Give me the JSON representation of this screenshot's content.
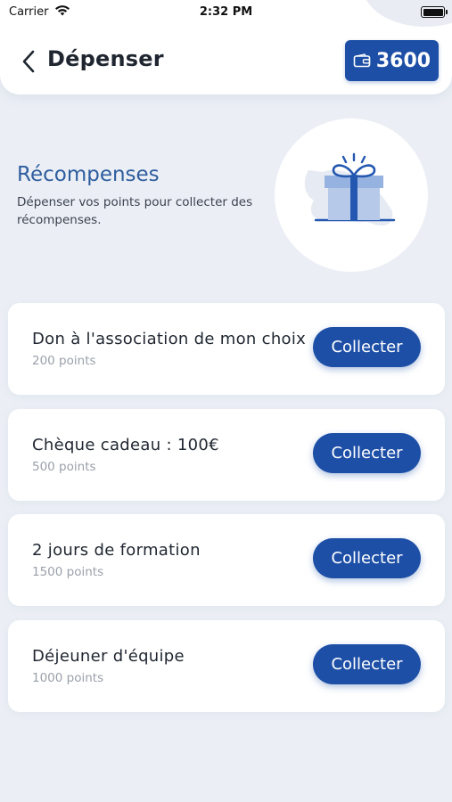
{
  "status_bar": {
    "carrier": "Carrier",
    "time": "2:32 PM"
  },
  "header": {
    "title": "Dépenser",
    "points_balance": "3600",
    "back_icon": "chevron-left-icon",
    "wallet_icon": "wallet-icon"
  },
  "hero": {
    "title": "Récompenses",
    "description": "Dépenser vos points pour collecter des récompenses.",
    "illustration_icon": "gift-icon"
  },
  "rewards": [
    {
      "title": "Don à l'association de mon choix",
      "points": "200 points",
      "button_label": "Collecter"
    },
    {
      "title": "Chèque cadeau : 100€",
      "points": "500 points",
      "button_label": "Collecter"
    },
    {
      "title": "2 jours de formation",
      "points": "1500 points",
      "button_label": "Collecter"
    },
    {
      "title": "Déjeuner d'équipe",
      "points": "1000 points",
      "button_label": "Collecter"
    }
  ],
  "colors": {
    "accent": "#1d4fa6",
    "background": "#ebeff5",
    "hero_title": "#2e5d9e",
    "muted_text": "#9aa0aa"
  }
}
